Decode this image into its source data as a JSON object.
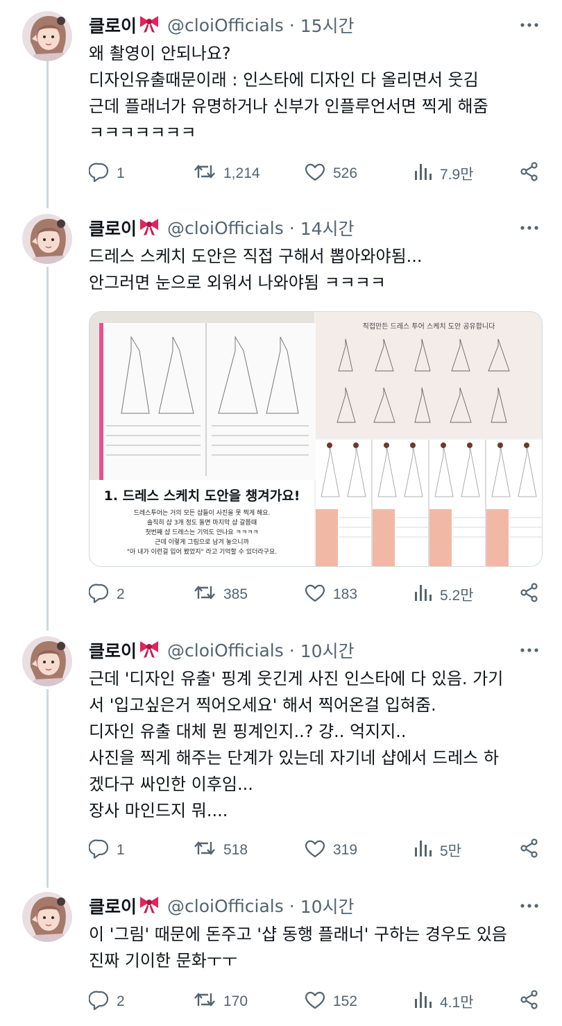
{
  "tweets": [
    {
      "name": "클로이",
      "handle": "@cloiOfficials",
      "time": "15시간",
      "lines": [
        "왜 촬영이 안되나요?",
        "디자인유출때문이래 : 인스타에 디자인 다 올리면서 웃김",
        "근데 플래너가 유명하거나 신부가 인플루언서면 찍게 해줌",
        "ㅋㅋㅋㅋㅋㅋㅋ"
      ],
      "replies": "1",
      "retweets": "1,214",
      "likes": "526",
      "views": "7.9만"
    },
    {
      "name": "클로이",
      "handle": "@cloiOfficials",
      "time": "14시간",
      "lines": [
        "드레스 스케치 도안은 직접 구해서 뽑아와야됨...",
        "안그러면 눈으로 외워서 나와야됨 ㅋㅋㅋㅋ"
      ],
      "media": {
        "left_caption": "1. 드레스 스케치 도안을 챙겨가요!",
        "left_text": [
          "드레스투어는 거의 모든 샵들이 사진을 못 찍게 해요.",
          "솔직히 샵 3개 정도 돌면 마지막 샵 갈쯤때",
          "첫번째 샵 드레스는 기억도 안나요 ㅋㅋㅋㅋ",
          "근데 이렇게 그림으로 남겨 놓으니까",
          "\"아 내가 이런걸 입어 봤었지\" 라고 기억할 수 있더라구요."
        ],
        "right_title": "직접만든 드레스 투어 스케치 도안 공유합니다"
      },
      "replies": "2",
      "retweets": "385",
      "likes": "183",
      "views": "5.2만"
    },
    {
      "name": "클로이",
      "handle": "@cloiOfficials",
      "time": "10시간",
      "lines": [
        "근데 '디자인 유출' 핑계 웃긴게 사진 인스타에 다 있음. 가기",
        "서 '입고싶은거 찍어오세요' 해서 찍어온걸 입혀줌.",
        "디자인 유출 대체 뭔 핑계인지..? 걍.. 억지지..",
        "사진을 찍게 해주는 단계가 있는데 자기네 샵에서 드레스 하",
        "겠다구 싸인한 이후임...",
        "장사 마인드지 뭐...."
      ],
      "replies": "1",
      "retweets": "518",
      "likes": "319",
      "views": "5만"
    },
    {
      "name": "클로이",
      "handle": "@cloiOfficials",
      "time": "10시간",
      "lines": [
        "이 '그림' 때문에 돈주고 '샵 동행 플래너' 구하는 경우도 있음",
        "진짜 기이한 문화ㅜㅜ"
      ],
      "replies": "2",
      "retweets": "170",
      "likes": "152",
      "views": "4.1만"
    }
  ],
  "icons": [
    "ribbon-bow-icon",
    "more-options-icon",
    "reply-icon",
    "retweet-icon",
    "like-icon",
    "views-icon",
    "share-icon"
  ],
  "colors": {
    "text": "#0f1419",
    "secondary": "#536471",
    "thread_line": "#cfd9de",
    "bow": "#e0245e"
  }
}
